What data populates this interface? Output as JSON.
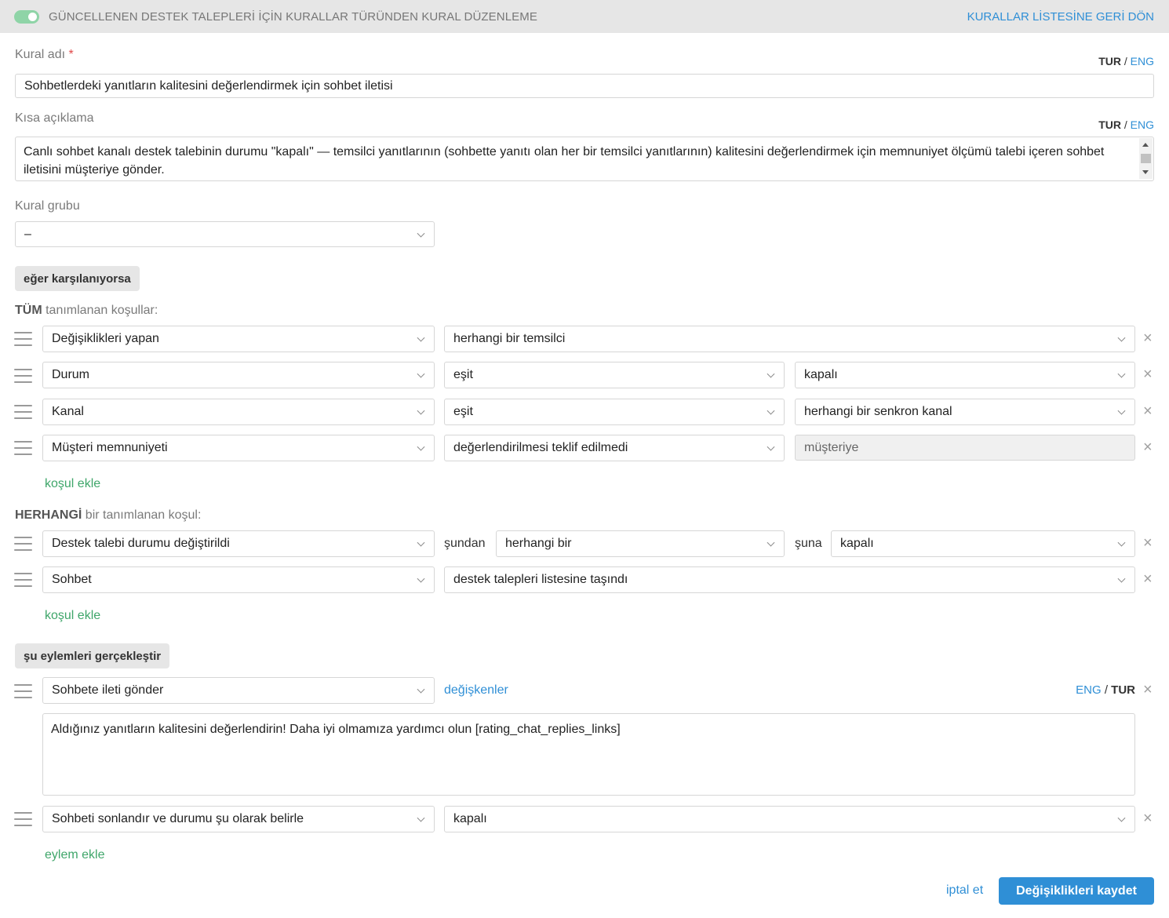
{
  "header": {
    "title": "GÜNCELLENEN DESTEK TALEPLERİ İÇİN KURALLAR TÜRÜNDEN KURAL DÜZENLEME",
    "back_link": "KURALLAR LİSTESİNE GERİ DÖN",
    "toggle_on": true
  },
  "form": {
    "rule_name": {
      "label": "Kural adı",
      "required_mark": "*",
      "lang_active": "TUR",
      "lang_sep": "/",
      "lang_other": "ENG",
      "value": "Sohbetlerdeki yanıtların kalitesini değerlendirmek için sohbet iletisi"
    },
    "short_desc": {
      "label": "Kısa açıklama",
      "lang_active": "TUR",
      "lang_sep": "/",
      "lang_other": "ENG",
      "value": "Canlı sohbet kanalı destek talebinin durumu \"kapalı\" —  temsilci yanıtlarının (sohbette yanıtı olan her bir temsilci yanıtlarının) kalitesini değerlendirmek için memnuniyet ölçümü talebi içeren sohbet iletisini müşteriye gönder."
    },
    "rule_group": {
      "label": "Kural grubu",
      "value": "–"
    }
  },
  "conditions": {
    "if_label": "eğer karşılanıyorsa",
    "all_label_bold": "TÜM",
    "all_label_rest": " tanımlanan koşullar:",
    "all_rows": [
      {
        "field": "Değişiklikleri yapan",
        "op": "herhangi bir temsilci",
        "value": ""
      },
      {
        "field": "Durum",
        "op": "eşit",
        "value": "kapalı"
      },
      {
        "field": "Kanal",
        "op": "eşit",
        "value": "herhangi bir senkron kanal"
      },
      {
        "field": "Müşteri memnuniyeti",
        "op": "değerlendirilmesi teklif edilmedi",
        "value": "müşteriye"
      }
    ],
    "add_condition": "koşul ekle",
    "any_label_bold": "HERHANGİ",
    "any_label_rest": " bir tanımlanan koşul:",
    "any_rows": [
      {
        "field": "Destek talebi durumu değiştirildi",
        "from_label": "şundan",
        "from": "herhangi bir",
        "to_label": "şuna",
        "to": "kapalı"
      },
      {
        "field": "Sohbet",
        "op": "destek talepleri listesine taşındı"
      }
    ],
    "add_condition_2": "koşul ekle"
  },
  "actions": {
    "label": "şu eylemleri gerçekleştir",
    "rows": [
      {
        "action": "Sohbete ileti gönder",
        "variables_link": "değişkenler",
        "lang_other": "ENG",
        "lang_sep": "/",
        "lang_active": "TUR",
        "message": "Aldığınız yanıtların kalitesini değerlendirin! Daha iyi olmamıza yardımcı olun [rating_chat_replies_links]"
      },
      {
        "action": "Sohbeti sonlandır ve durumu şu olarak belirle",
        "value": "kapalı"
      }
    ],
    "add_action": "eylem ekle"
  },
  "footer": {
    "cancel": "iptal et",
    "save": "Değişiklikleri kaydet"
  },
  "icons": {
    "close": "×",
    "drag": "drag-handle-icon",
    "chevron": "chevron-down-icon"
  },
  "colors": {
    "accent": "#2f8fd6",
    "green_link": "#3fa66a",
    "header_bg": "#e6e6e6",
    "toggle": "#8fd4a7",
    "required": "#e04848"
  }
}
